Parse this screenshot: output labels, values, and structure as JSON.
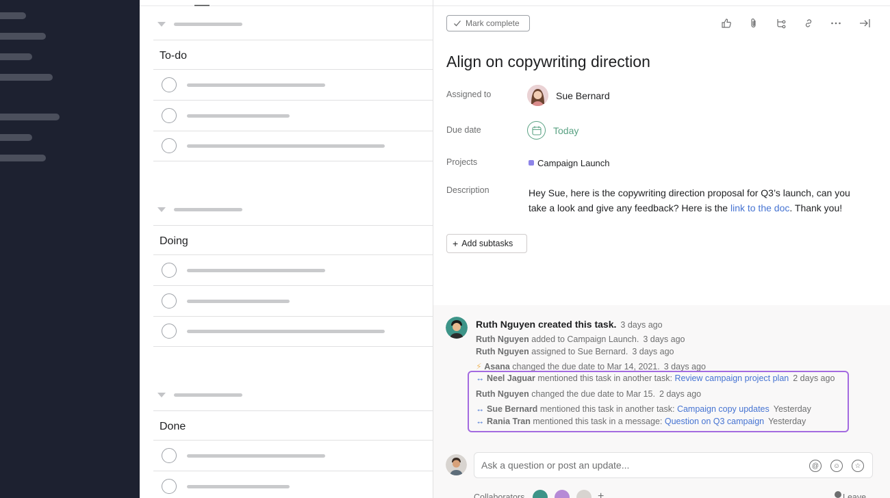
{
  "task": {
    "mark_complete": "Mark complete",
    "title": "Align on copywriting direction",
    "assigned_label": "Assigned to",
    "assignee": "Sue Bernard",
    "due_label": "Due date",
    "due_value": "Today",
    "projects_label": "Projects",
    "project": "Campaign Launch",
    "description_label": "Description",
    "description_pre": "Hey Sue, here is the copywriting direction proposal for Q3’s launch, can you take a look and give any feedback? Here is the ",
    "description_link": "link to the doc",
    "description_post": ". Thank you!",
    "add_subtasks": "Add subtasks"
  },
  "sections": [
    {
      "title": "To-do"
    },
    {
      "title": "Doing"
    },
    {
      "title": "Done"
    }
  ],
  "activity": {
    "creator": "Ruth Nguyen created this task.",
    "creator_time": "3 days ago",
    "lines": [
      {
        "actor": "Ruth Nguyen",
        "text": "added to Campaign Launch.",
        "time": "3 days ago"
      },
      {
        "actor": "Ruth Nguyen",
        "text": "assigned to Sue Bernard.",
        "time": "3 days ago"
      },
      {
        "actor": "Asana",
        "text": "changed the due date to Mar 14, 2021.",
        "time": "3 days ago"
      },
      {
        "actor": "Neel Jaguar",
        "text": "mentioned this task in another task:",
        "link": "Review campaign project plan",
        "time": "2 days ago"
      },
      {
        "actor": "Ruth Nguyen",
        "text": "changed the due date to Mar 15.",
        "time": "2 days ago"
      },
      {
        "actor": "Sue Bernard",
        "text": "mentioned this task in another task:",
        "link": "Campaign copy updates",
        "time": "Yesterday"
      },
      {
        "actor": "Rania Tran",
        "text": "mentioned this task in a message:",
        "link": "Question on Q3 campaign",
        "time": "Yesterday"
      }
    ]
  },
  "comment": {
    "placeholder": "Ask a question or post an update...",
    "collaborators": "Collaborators",
    "leave": "Leave"
  },
  "colors": {
    "sidebar": "#1d2130",
    "accent_link": "#4573d2",
    "due_green": "#58a182",
    "project_purple": "#8d84e8",
    "highlight": "#a36ae0"
  }
}
